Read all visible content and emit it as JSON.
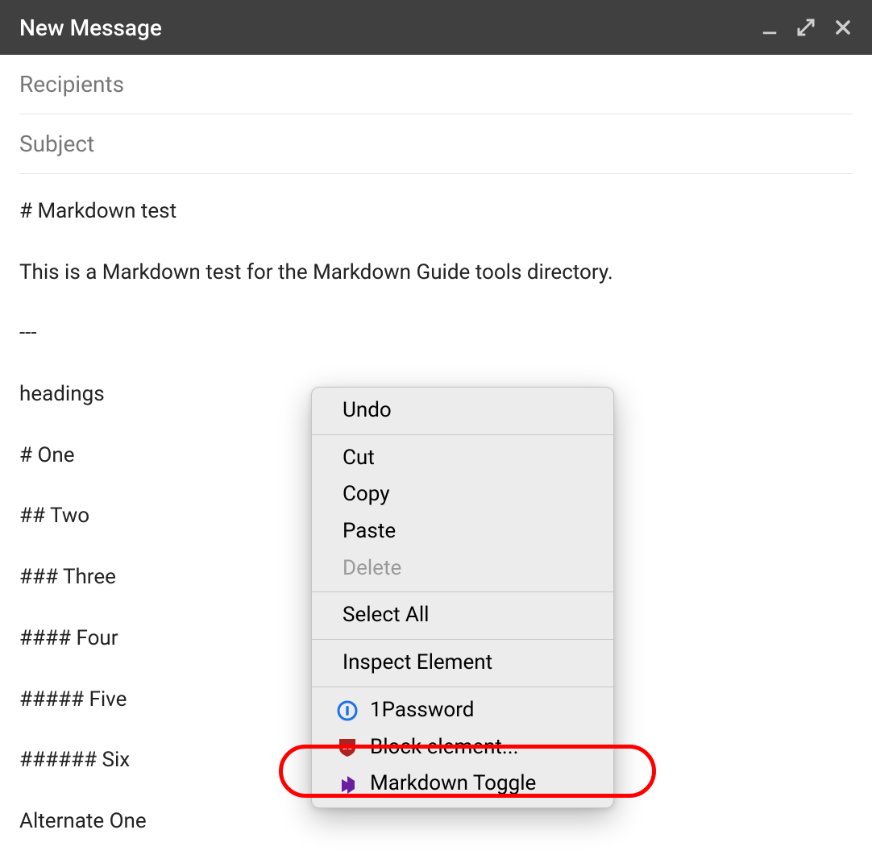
{
  "titlebar": {
    "title": "New Message"
  },
  "fields": {
    "recipients_placeholder": "Recipients",
    "subject_placeholder": "Subject"
  },
  "body_lines": [
    "# Markdown test",
    "This is a Markdown test for the Markdown Guide tools directory.",
    "---",
    "headings",
    "# One",
    "## Two",
    "### Three",
    "#### Four",
    "##### Five",
    "###### Six",
    "Alternate One"
  ],
  "context_menu": {
    "undo": "Undo",
    "cut": "Cut",
    "copy": "Copy",
    "paste": "Paste",
    "delete": "Delete",
    "select_all": "Select All",
    "inspect": "Inspect Element",
    "onepassword": "1Password",
    "block_element": "Block element...",
    "markdown_toggle": "Markdown Toggle"
  }
}
